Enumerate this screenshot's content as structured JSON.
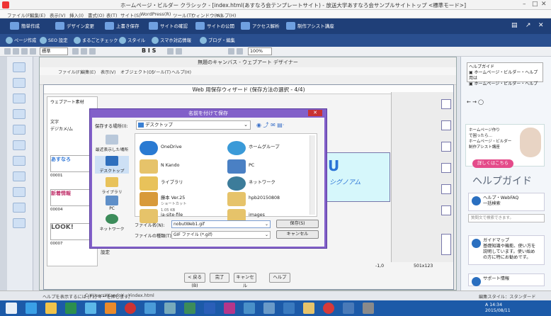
{
  "app": {
    "title": "ホームページ・ビルダー クラシック - [index.html(あすなろ会テンプレートサイト) - 放送大学あすなろ会サンプルサイトトップ <標準モード>]",
    "window_controls": [
      "–",
      "□",
      "✕"
    ]
  },
  "menu": [
    "ファイル(F)",
    "編集(E)",
    "表示(V)",
    "挿入(I)",
    "書式(O)",
    "表(T)",
    "サイト(S)",
    "WordPress(R)",
    "ツール(T)",
    "ウィンドウ(W)",
    "ヘルプ(H)"
  ],
  "ribbon1": [
    "簡単作成",
    "デザイン変更",
    "上書き保存",
    "サイトの確認",
    "サイトの公開",
    "アクセス解析",
    "制作アシスト講座"
  ],
  "ribbon2": [
    "ページ作成",
    "SEO 設定",
    "まるごとチェック",
    "スタイル",
    "スマホ対応情報",
    "ブログ・編集"
  ],
  "toolbar3": {
    "mode": "標準",
    "zoom": "100%"
  },
  "designer": {
    "title": "無題のキャンバス - ウェブアート デザイナー",
    "menu": [
      "ファイル(F)",
      "編集(E)",
      "表示(V)",
      "オブジェクト(O)",
      "ツール(T)",
      "ヘルプ(H)"
    ]
  },
  "wizard": {
    "title": "Web 用保存ウィザード (保存方法の選択 - 4/4)",
    "tabs": [
      "ウェブアート素材",
      "素材"
    ],
    "left_labels": [
      "文字",
      "デジカメ/ム"
    ],
    "templates": [
      "あすなろ",
      "新着情報",
      "LOOK!"
    ],
    "template_codes": [
      "00001",
      "00004",
      "00007"
    ],
    "settings_label": "設定",
    "buttons": {
      "back": "< 戻る(B)",
      "finish": "完了",
      "cancel": "キャンセル",
      "help": "ヘルプ"
    }
  },
  "canvas": {
    "logo": "U",
    "subtitle": "シグノアム",
    "coord": "-1,0",
    "size": "501x123"
  },
  "save_dialog": {
    "title": "名前を付けて保存",
    "close": "✕",
    "save_in_label": "保存する場所(I):",
    "save_in_value": "デスクトップ",
    "places": [
      "最近表示した場所",
      "デスクトップ",
      "ライブラリ",
      "PC",
      "ネットワーク"
    ],
    "files": [
      {
        "name": "OneDrive",
        "meta": ""
      },
      {
        "name": "ホームグループ",
        "meta": ""
      },
      {
        "name": "N Kando",
        "meta": ""
      },
      {
        "name": "PC",
        "meta": ""
      },
      {
        "name": "ライブラリ",
        "meta": ""
      },
      {
        "name": "ネットワーク",
        "meta": ""
      },
      {
        "name": "藤本 Ver.25",
        "meta": "ショートカット\n1.05 KB"
      },
      {
        "name": "hpb20150808",
        "meta": ""
      },
      {
        "name": "ia-site-file",
        "meta": ""
      },
      {
        "name": "images",
        "meta": ""
      }
    ],
    "filename_label": "ファイル名(N):",
    "filename_value": "nobutWeb1.gif",
    "filetype_label": "ファイルの種類(T):",
    "filetype_value": "GIF ファイル (*.gif)",
    "save_button": "保存(S)",
    "cancel_button": "キャンセル"
  },
  "help_panel": {
    "header": "ヘルプガイド\n▣ ホームページ・ビルダー・ヘルプ用は\n▣ ホームページ・ビルダー・ヘルプ",
    "nav": "← → ◯",
    "ad_text": "ホームページ作り\nで困ったら…\nホームページ・ビルダー\n制作アシスト講座",
    "ad_button": "詳しくはこちら",
    "big_title": "ヘルプガイド",
    "sections": [
      {
        "title": "ヘルプ・WebFAQ",
        "text": "一括検索"
      },
      {
        "title": "ガイドマップ",
        "text": "基礎知識や機能、使い方を\n説明しています。使い始め\nの方に特にお勧めです。"
      },
      {
        "title": "サポート情報",
        "text": ""
      }
    ],
    "keyword_hint": "質問文で検索できます。"
  },
  "statusbar": {
    "hint": "ヘルプを表示するには [F1] キーを押します。",
    "path": "C:¥Users¥Kando¥...¥index.html",
    "style": "編集スタイル：スタンダード"
  },
  "taskbar": {
    "tray": "A 14:34\n2015/08/11"
  },
  "colors": {
    "ribbon": "#1f3f78",
    "dialog": "#8260c9",
    "taskbar": "#1c5aa8",
    "accent": "#e44b8a"
  }
}
